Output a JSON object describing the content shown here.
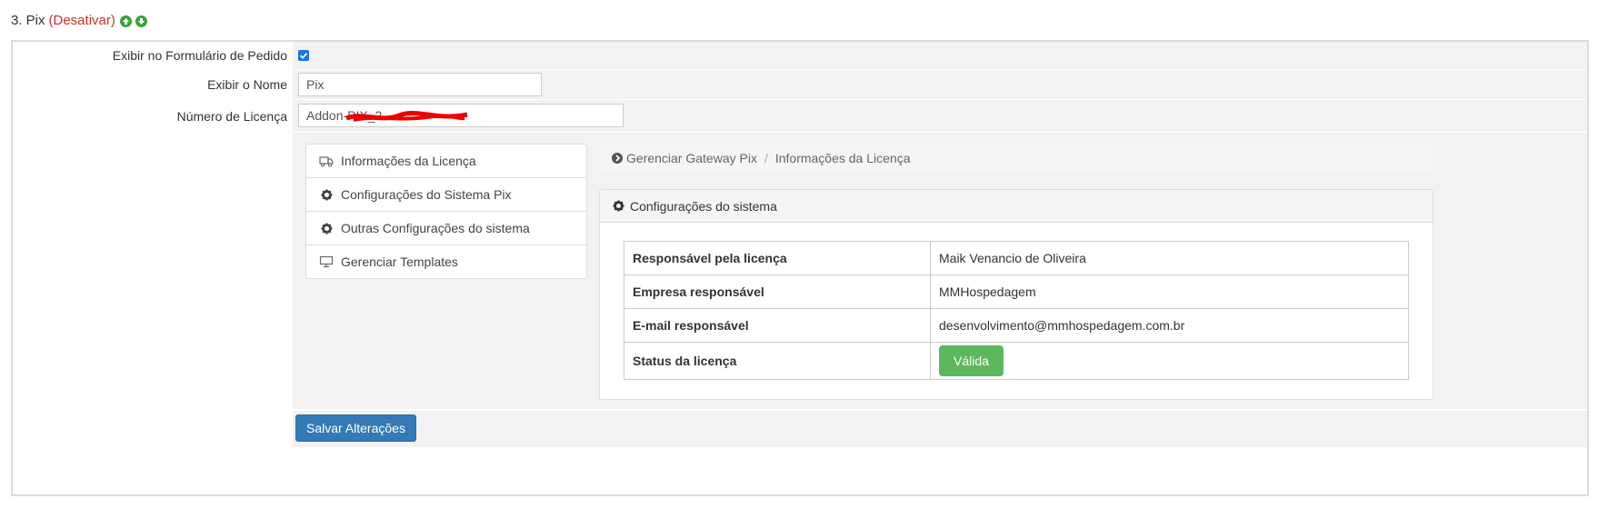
{
  "header": {
    "title": "3. Pix",
    "deactivate": "(Desativar)",
    "move_up_icon": "arrow-up-circle",
    "move_down_icon": "arrow-down-circle"
  },
  "form": {
    "show_on_order": {
      "label": "Exibir no Formulário de Pedido",
      "checked": true
    },
    "display_name": {
      "label": "Exibir o Nome",
      "value": "Pix"
    },
    "license_number": {
      "label": "Número de Licença",
      "value": "Addon-PIX_2"
    }
  },
  "menu": {
    "items": [
      {
        "label": "Informações da Licença",
        "icon": "truck-icon"
      },
      {
        "label": "Configurações do Sistema Pix",
        "icon": "gear-icon"
      },
      {
        "label": "Outras Configurações do sistema",
        "icon": "gear-icon"
      },
      {
        "label": "Gerenciar Templates",
        "icon": "monitor-icon"
      }
    ]
  },
  "breadcrumb": {
    "root": "Gerenciar Gateway Pix",
    "current": "Informações da Licença"
  },
  "card": {
    "title": "Configurações do sistema",
    "rows": [
      {
        "key": "Responsável pela licença",
        "value": "Maik Venancio de Oliveira"
      },
      {
        "key": "Empresa responsável",
        "value": "MMHospedagem"
      },
      {
        "key": "E-mail responsável",
        "value": "desenvolvimento@mmhospedagem.com.br"
      },
      {
        "key": "Status da licença",
        "value": "Válida"
      }
    ]
  },
  "save_button": "Salvar Alterações",
  "colors": {
    "deactivate": "#c9302c",
    "valid_badge": "#5cb85c",
    "save_button": "#337ab7",
    "arrow_icons": "#3aa33a"
  }
}
